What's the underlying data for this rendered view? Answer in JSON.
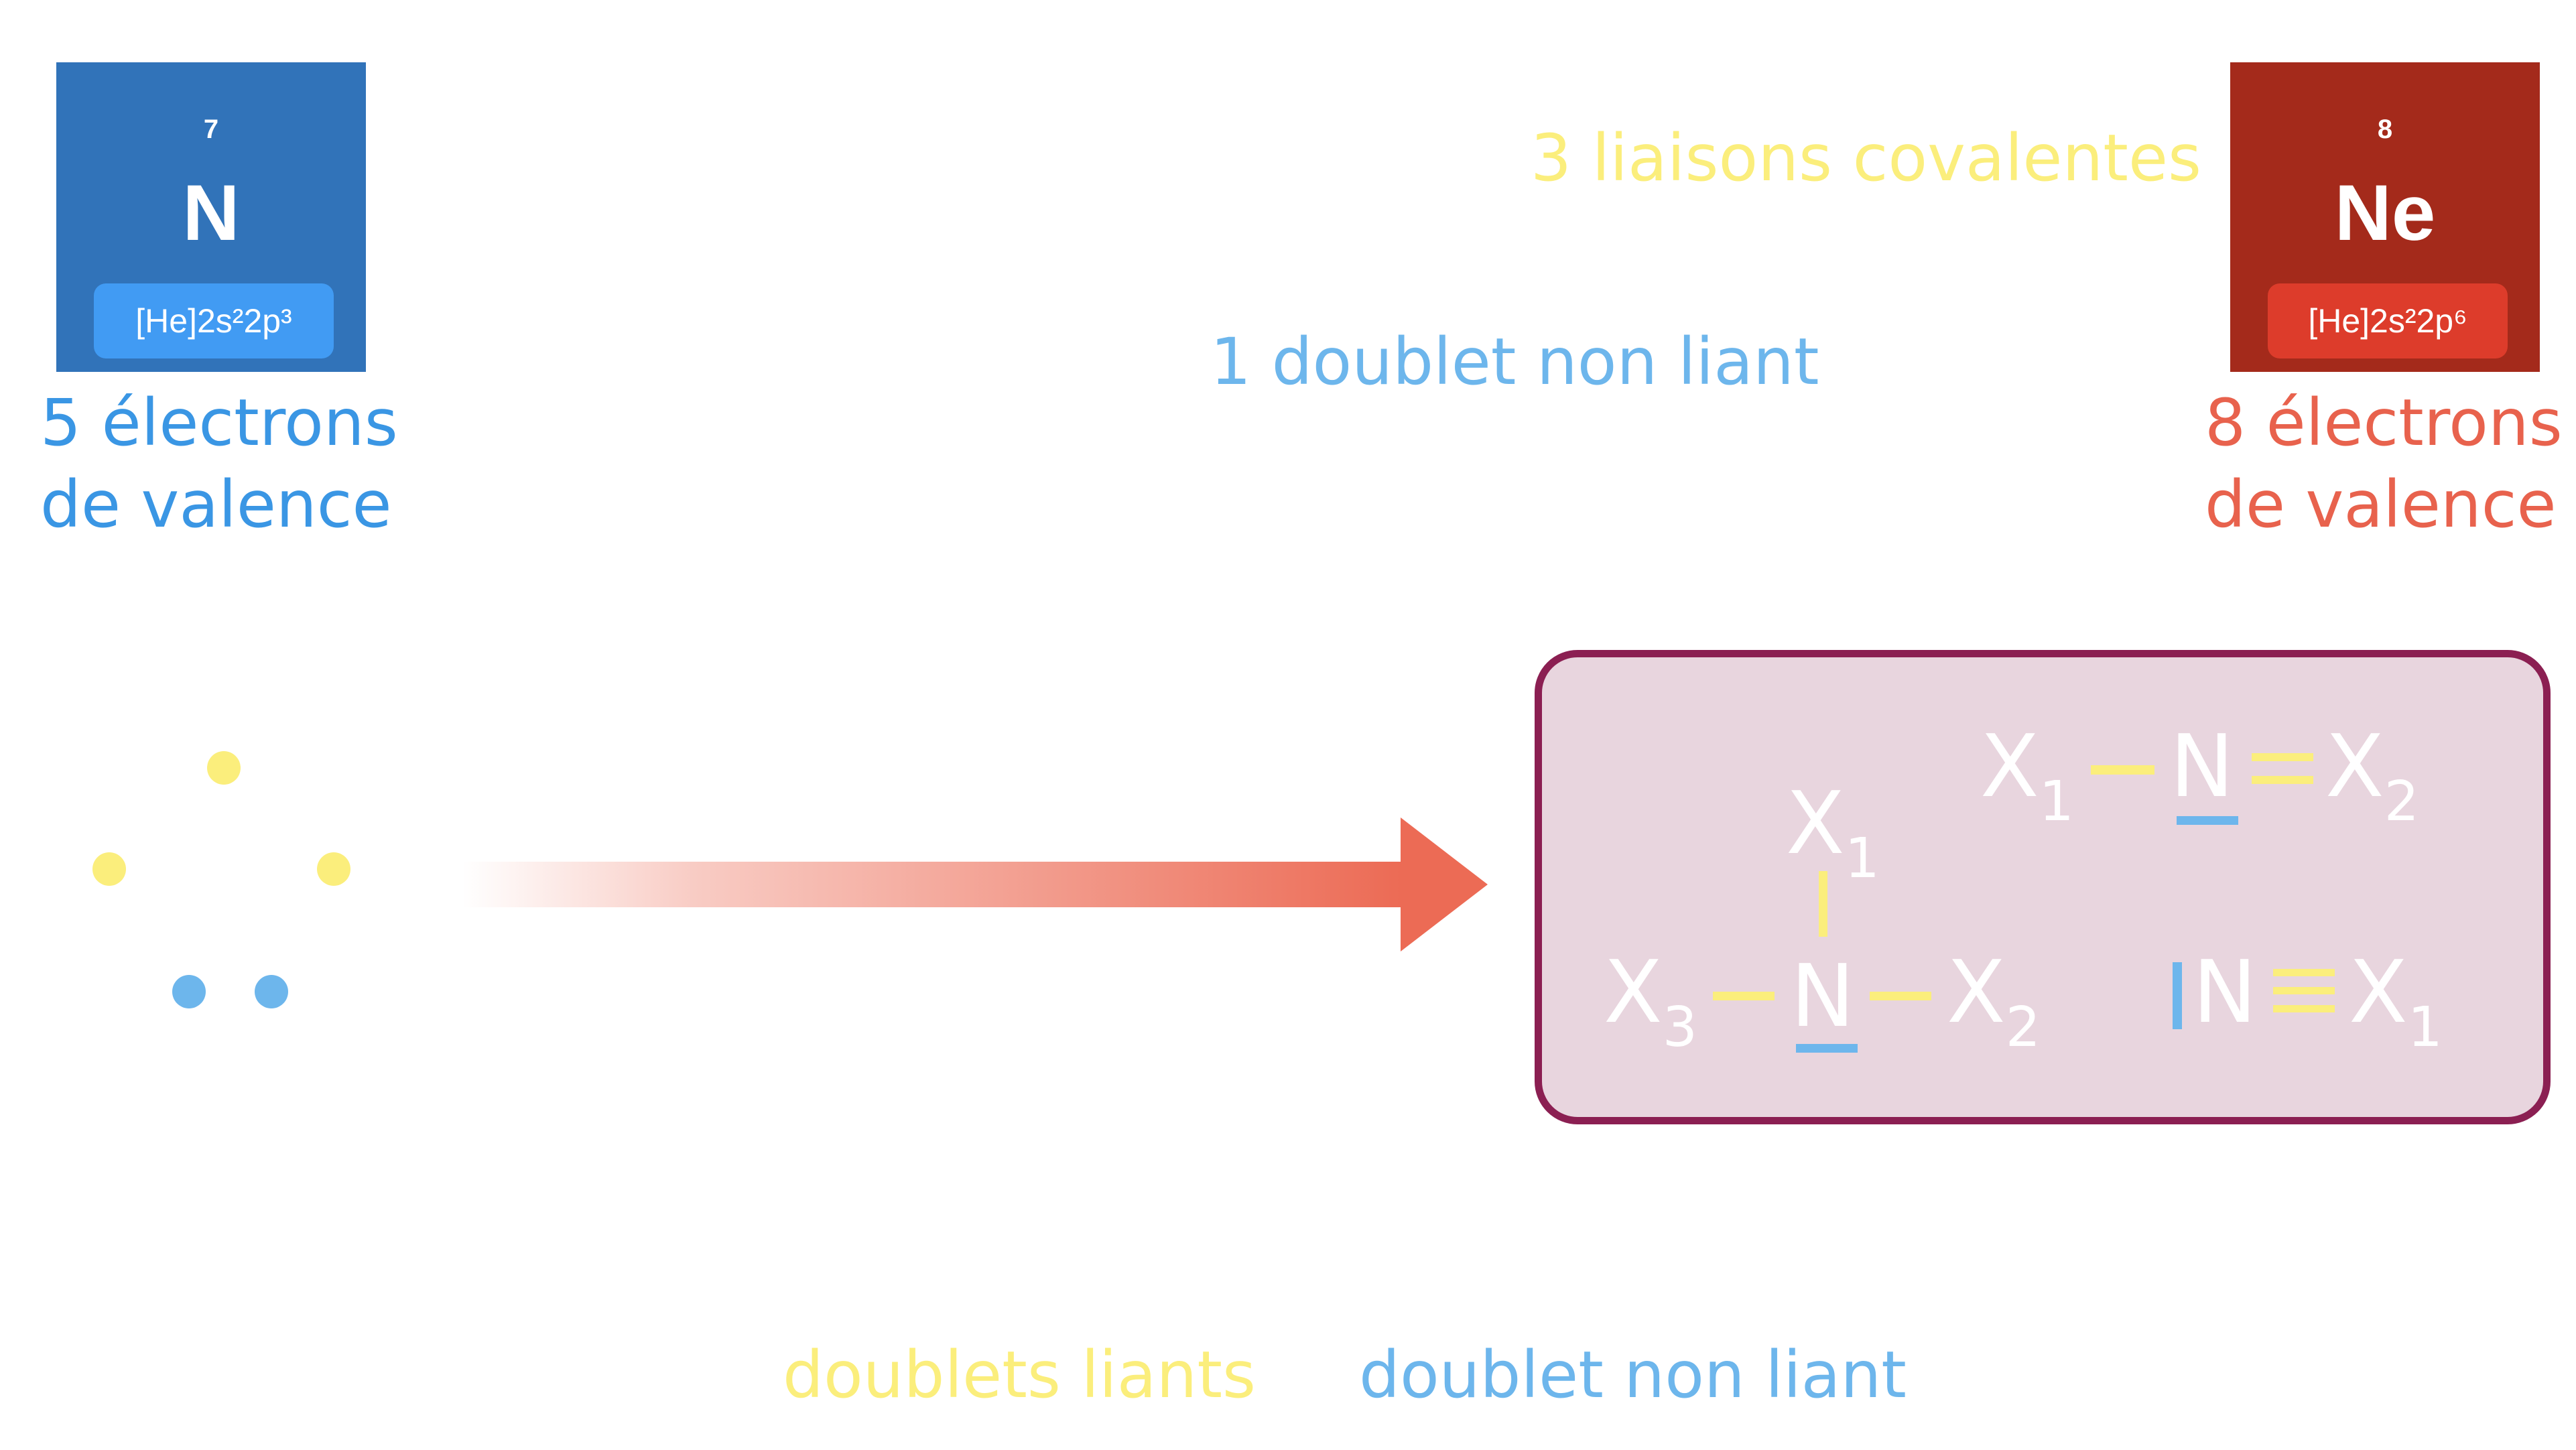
{
  "colors": {
    "blue": "#3173b9",
    "blue_badge": "#419bf3",
    "red": "#a42a1b",
    "red_badge": "#dd3c2b",
    "valence_blue": "#3a96e4",
    "valence_red": "#e8624d",
    "yellow": "#fbee7c",
    "light_blue": "#6db6ec",
    "arrow": "#ec6b55",
    "box_fill": "#e8d5de",
    "box_border": "#8b1f52"
  },
  "nitrogen": {
    "atomic_number": "7",
    "symbol": "N",
    "configuration": "[He]2s²2p³",
    "valence_line1": "5 électrons",
    "valence_line2": "de valence"
  },
  "neon": {
    "atomic_number": "8",
    "symbol": "Ne",
    "configuration": "[He]2s²2p⁶",
    "valence_line1": "8 électrons",
    "valence_line2": "de valence"
  },
  "labels": {
    "covalent_bonds": "3 liaisons covalentes",
    "lone_pair_top": "1 doublet non liant",
    "bonding_pairs": "doublets liants",
    "lone_pair_bottom": "doublet non liant"
  },
  "formulas": {
    "x": "X",
    "n": "N",
    "sub1": "1",
    "sub2": "2",
    "sub3": "3",
    "lone_pair_bar": "I"
  }
}
